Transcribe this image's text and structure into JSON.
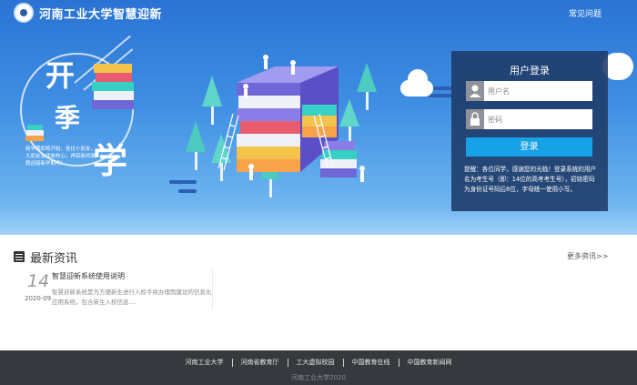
{
  "header": {
    "site_title": "河南工业大学智慧迎新",
    "faq_link": "常见问题"
  },
  "hero": {
    "slogan_chars": [
      "开",
      "季",
      "学"
    ],
    "slogan_sub": "新学期即将开始，各位小朋友，大朋友会找收核心，再崭新的面貌迎接新学期吧！"
  },
  "login": {
    "title": "用户登录",
    "username_placeholder": "用户名",
    "password_placeholder": "密码",
    "submit_label": "登录",
    "hint": "提醒：各位同学，感谢您的光临！登录系统的用户名为考生号（即：14位的高考考生号），初始密码为身份证号码后6位，字母统一使用小写。"
  },
  "news": {
    "section_title": "最新资讯",
    "more_label": "更多资讯>>",
    "items": [
      {
        "day": "14",
        "month": "2020-09",
        "title": "智慧迎新系统使用说明",
        "summary": "智慧迎新系统是为方便新生进行入校手续办理而建设的信息化应用系统，包含新生入校信息...."
      }
    ]
  },
  "footer": {
    "links": [
      "河南工业大学",
      "河南省教育厅",
      "工大虚拟校园",
      "中国教育在线",
      "中国教育新闻网"
    ],
    "copyright": "河南工业大学2020"
  },
  "colors": {
    "hero_top": "#2a73d4",
    "login_panel": "#1e3a66",
    "login_button": "#17a1e6",
    "footer_bg": "#36393e"
  }
}
